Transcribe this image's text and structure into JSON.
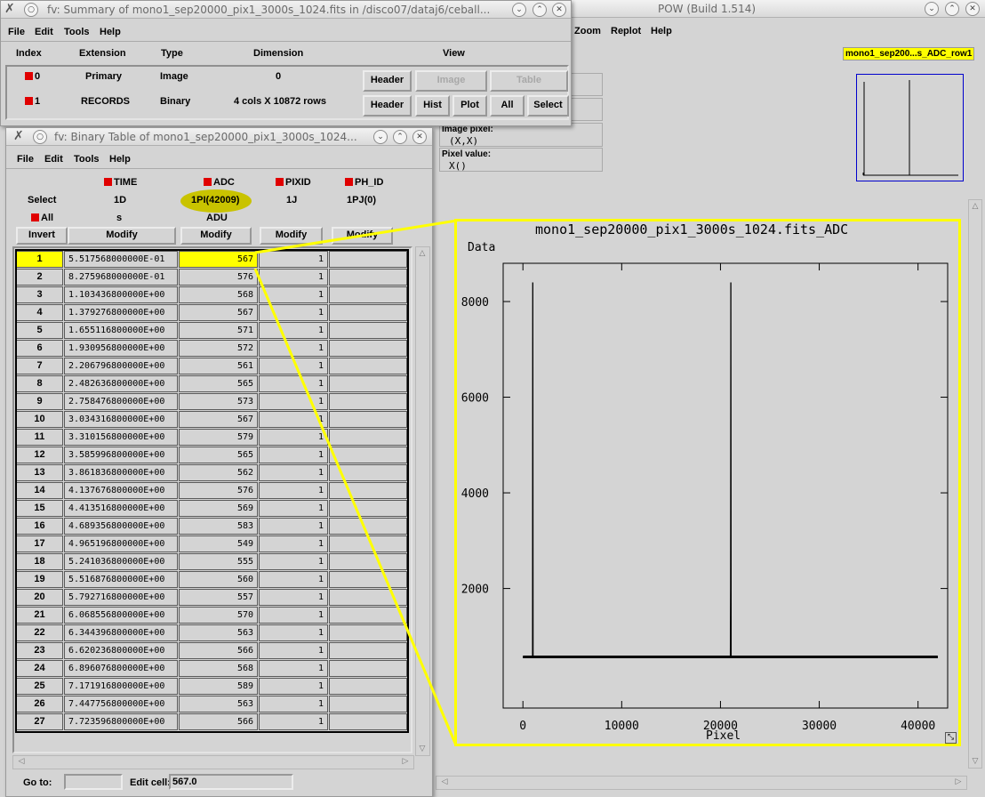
{
  "pow": {
    "title": "POW (Build 1.514)",
    "menus": [
      "Zoom",
      "Replot",
      "Help"
    ],
    "info": {
      "image_pixel_label": "Image pixel:",
      "image_pixel_value": "(X,X)",
      "pixel_value_label": "Pixel value:",
      "pixel_value_value": "X()"
    },
    "thumb_label": "mono1_sep200...s_ADC_row1"
  },
  "plot": {
    "title": "mono1_sep20000_pix1_3000s_1024.fits_ADC",
    "ylabel": "Data",
    "xlabel": "Pixel",
    "xticks": [
      "0",
      "10000",
      "20000",
      "30000",
      "40000"
    ],
    "yticks": [
      "2000",
      "4000",
      "6000",
      "8000"
    ]
  },
  "chart_data": {
    "type": "line",
    "title": "mono1_sep20000_pix1_3000s_1024.fits_ADC",
    "xlabel": "Pixel",
    "ylabel": "Data",
    "xlim": [
      -2000,
      43000
    ],
    "ylim": [
      -500,
      8800
    ],
    "grid": false,
    "series": [
      {
        "x": [
          0,
          980,
          1000,
          1020,
          21000,
          21030,
          21050,
          21080,
          42000
        ],
        "y": [
          560,
          560,
          8400,
          560,
          560,
          2050,
          8400,
          560,
          560
        ]
      }
    ]
  },
  "summary": {
    "title": "fv: Summary of mono1_sep20000_pix1_3000s_1024.fits in /disco07/dataj6/ceball...",
    "menus": [
      "File",
      "Edit",
      "Tools",
      "Help"
    ],
    "headers": {
      "index": "Index",
      "extension": "Extension",
      "type": "Type",
      "dimension": "Dimension",
      "view": "View"
    },
    "rows": [
      {
        "index": "0",
        "extension": "Primary",
        "type": "Image",
        "dimension": "0"
      },
      {
        "index": "1",
        "extension": "RECORDS",
        "type": "Binary",
        "dimension": "4 cols X 10872 rows"
      }
    ],
    "buttons_row0": [
      "Header",
      "Image",
      "Table"
    ],
    "buttons_row1": [
      "Header",
      "Hist",
      "Plot",
      "All",
      "Select"
    ]
  },
  "table": {
    "title": "fv: Binary Table of mono1_sep20000_pix1_3000s_1024...",
    "menus": [
      "File",
      "Edit",
      "Tools",
      "Help"
    ],
    "select_label": "Select",
    "all_label": "All",
    "invert_label": "Invert",
    "modify_label": "Modify",
    "columns": [
      {
        "name": "TIME",
        "format": "1D",
        "unit": "s"
      },
      {
        "name": "ADC",
        "format": "1PI(42009)",
        "unit": "ADU"
      },
      {
        "name": "PIXID",
        "format": "1J",
        "unit": ""
      },
      {
        "name": "PH_ID",
        "format": "1PJ(0)",
        "unit": ""
      }
    ],
    "rows": [
      {
        "n": "1",
        "time": "5.517568000000E-01",
        "adc": "567",
        "pixid": "1"
      },
      {
        "n": "2",
        "time": "8.275968000000E-01",
        "adc": "576",
        "pixid": "1"
      },
      {
        "n": "3",
        "time": "1.103436800000E+00",
        "adc": "568",
        "pixid": "1"
      },
      {
        "n": "4",
        "time": "1.379276800000E+00",
        "adc": "567",
        "pixid": "1"
      },
      {
        "n": "5",
        "time": "1.655116800000E+00",
        "adc": "571",
        "pixid": "1"
      },
      {
        "n": "6",
        "time": "1.930956800000E+00",
        "adc": "572",
        "pixid": "1"
      },
      {
        "n": "7",
        "time": "2.206796800000E+00",
        "adc": "561",
        "pixid": "1"
      },
      {
        "n": "8",
        "time": "2.482636800000E+00",
        "adc": "565",
        "pixid": "1"
      },
      {
        "n": "9",
        "time": "2.758476800000E+00",
        "adc": "573",
        "pixid": "1"
      },
      {
        "n": "10",
        "time": "3.034316800000E+00",
        "adc": "567",
        "pixid": "1"
      },
      {
        "n": "11",
        "time": "3.310156800000E+00",
        "adc": "579",
        "pixid": "1"
      },
      {
        "n": "12",
        "time": "3.585996800000E+00",
        "adc": "565",
        "pixid": "1"
      },
      {
        "n": "13",
        "time": "3.861836800000E+00",
        "adc": "562",
        "pixid": "1"
      },
      {
        "n": "14",
        "time": "4.137676800000E+00",
        "adc": "576",
        "pixid": "1"
      },
      {
        "n": "15",
        "time": "4.413516800000E+00",
        "adc": "569",
        "pixid": "1"
      },
      {
        "n": "16",
        "time": "4.689356800000E+00",
        "adc": "583",
        "pixid": "1"
      },
      {
        "n": "17",
        "time": "4.965196800000E+00",
        "adc": "549",
        "pixid": "1"
      },
      {
        "n": "18",
        "time": "5.241036800000E+00",
        "adc": "555",
        "pixid": "1"
      },
      {
        "n": "19",
        "time": "5.516876800000E+00",
        "adc": "560",
        "pixid": "1"
      },
      {
        "n": "20",
        "time": "5.792716800000E+00",
        "adc": "557",
        "pixid": "1"
      },
      {
        "n": "21",
        "time": "6.068556800000E+00",
        "adc": "570",
        "pixid": "1"
      },
      {
        "n": "22",
        "time": "6.344396800000E+00",
        "adc": "563",
        "pixid": "1"
      },
      {
        "n": "23",
        "time": "6.620236800000E+00",
        "adc": "566",
        "pixid": "1"
      },
      {
        "n": "24",
        "time": "6.896076800000E+00",
        "adc": "568",
        "pixid": "1"
      },
      {
        "n": "25",
        "time": "7.171916800000E+00",
        "adc": "589",
        "pixid": "1"
      },
      {
        "n": "26",
        "time": "7.447756800000E+00",
        "adc": "563",
        "pixid": "1"
      },
      {
        "n": "27",
        "time": "7.723596800000E+00",
        "adc": "566",
        "pixid": "1"
      }
    ],
    "goto_label": "Go to:",
    "goto_value": "",
    "edit_cell_label": "Edit cell:",
    "edit_cell_value": "567.0"
  },
  "colors": {
    "highlight": "#ffff00",
    "marker": "#e00000",
    "pow_frame": "#ffff00",
    "thumb_frame": "#0000cc"
  }
}
